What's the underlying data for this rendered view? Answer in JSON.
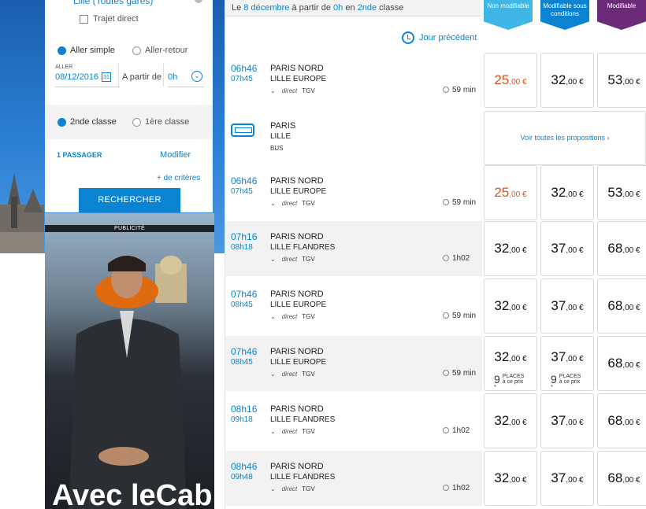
{
  "search": {
    "destination": "Lille (Toutes gares)",
    "direct_label": "Trajet direct",
    "one_way_label": "Aller simple",
    "round_trip_label": "Aller-retour",
    "aller_label": "ALLER",
    "date": "08/12/2016",
    "from_label": "A partir de",
    "hour": "0h",
    "class2_label": "2nde classe",
    "class1_label": "1ère classe",
    "passenger_label": "1 PASSAGER",
    "modify_label": "Modifier",
    "criteria_label": "+ de critères",
    "search_button": "RECHERCHER"
  },
  "ad": {
    "tag": "PUBLICITÉ",
    "title": "Avec leCab,"
  },
  "header": {
    "pre": "Le ",
    "date": "8 décembre",
    "mid": " à partir de ",
    "hour": "0h",
    "post1": " en ",
    "cls": "2nde",
    "post2": " classe",
    "prev_day": "Jour précédent"
  },
  "fare_types": [
    "Non modifiable",
    "Modifiable sous conditions",
    "Modifiable"
  ],
  "colors": {
    "accent": "#0a84d0",
    "light_blue": "#3fb6e6",
    "purple": "#6c2b79",
    "orange": "#d9531e"
  },
  "trips": [
    {
      "dep": "06h46",
      "arr": "07h45",
      "from": "PARIS NORD",
      "to": "LILLE EUROPE",
      "mode": "direct",
      "type": "TGV",
      "duration": "59 min",
      "prices": [
        "25",
        "32",
        "53"
      ],
      "cents": ",00 €"
    },
    {
      "dep": "06h46",
      "arr": "07h45",
      "from": "PARIS NORD",
      "to": "LILLE EUROPE",
      "mode": "direct",
      "type": "TGV",
      "duration": "59 min",
      "prices": [
        "25",
        "32",
        "53"
      ],
      "cents": ",00 €"
    },
    {
      "dep": "07h16",
      "arr": "08h18",
      "from": "PARIS NORD",
      "to": "LILLE FLANDRES",
      "mode": "direct",
      "type": "TGV",
      "duration": "1h02",
      "prices": [
        "32",
        "37",
        "68"
      ],
      "cents": ",00 €"
    },
    {
      "dep": "07h46",
      "arr": "08h45",
      "from": "PARIS NORD",
      "to": "LILLE EUROPE",
      "mode": "direct",
      "type": "TGV",
      "duration": "59 min",
      "prices": [
        "32",
        "37",
        "68"
      ],
      "cents": ",00 €"
    },
    {
      "dep": "07h46",
      "arr": "08h45",
      "from": "PARIS NORD",
      "to": "LILLE EUROPE",
      "mode": "direct",
      "type": "TGV",
      "duration": "59 min",
      "prices": [
        "32",
        "37",
        "68"
      ],
      "cents": ",00 €",
      "places": "9",
      "places_label": "PLACES",
      "places_sub": "à ce prix *"
    },
    {
      "dep": "08h16",
      "arr": "09h18",
      "from": "PARIS NORD",
      "to": "LILLE FLANDRES",
      "mode": "direct",
      "type": "TGV",
      "duration": "1h02",
      "prices": [
        "32",
        "37",
        "68"
      ],
      "cents": ",00 €"
    },
    {
      "dep": "08h46",
      "arr": "09h48",
      "from": "PARIS NORD",
      "to": "LILLE FLANDRES",
      "mode": "direct",
      "type": "TGV",
      "duration": "1h02",
      "prices": [
        "32",
        "37",
        "68"
      ],
      "cents": ",00 €"
    }
  ],
  "bus": {
    "from": "PARIS",
    "to": "LILLE",
    "type": "BUS",
    "all_props": "Voir toutes les propositions"
  }
}
